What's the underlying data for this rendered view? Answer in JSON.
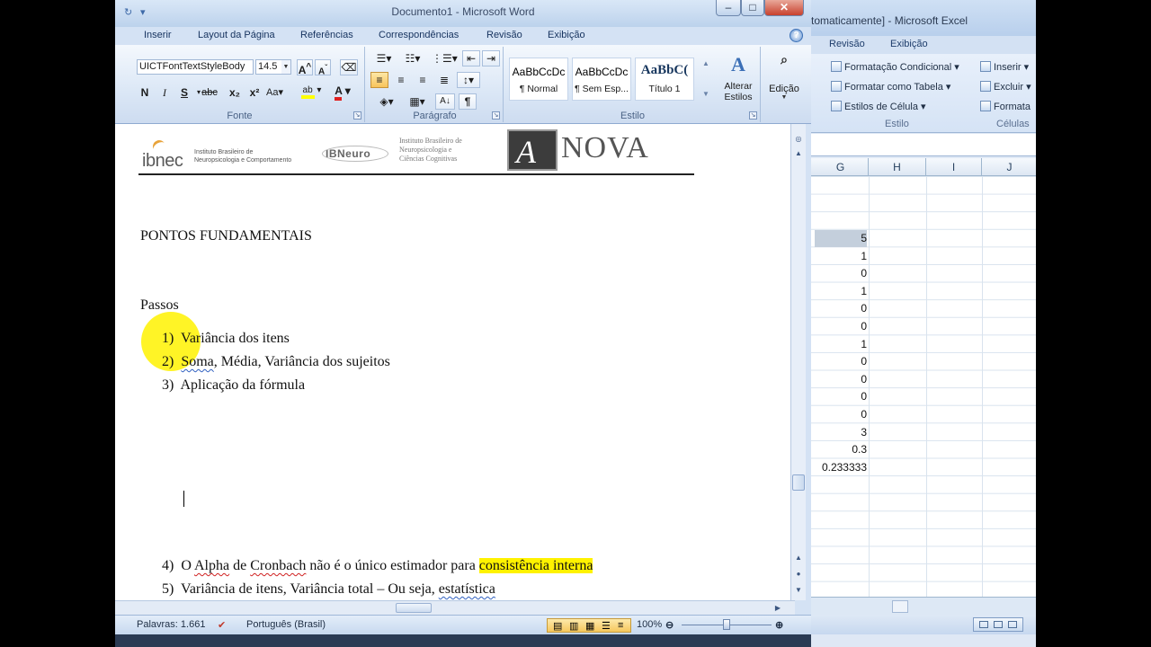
{
  "excel": {
    "title": "tomaticamente] - Microsoft Excel",
    "tabs": [
      "Revisão",
      "Exibição"
    ],
    "ribbon": {
      "conditional_formatting": "Formatação Condicional",
      "format_as_table": "Formatar como Tabela",
      "cell_styles": "Estilos de Célula",
      "insert": "Inserir",
      "delete": "Excluir",
      "format": "Formata",
      "group_styles": "Estilo",
      "group_cells": "Células"
    },
    "columns": [
      "G",
      "H",
      "I",
      "J"
    ],
    "cells": [
      "5",
      "1",
      "0",
      "1",
      "0",
      "0",
      "1",
      "0",
      "0",
      "0",
      "0",
      "3",
      "0.3",
      "0.233333"
    ]
  },
  "word": {
    "title": "Documento1 - Microsoft Word",
    "tabs": [
      "Inserir",
      "Layout da Página",
      "Referências",
      "Correspondências",
      "Revisão",
      "Exibição"
    ],
    "font": {
      "name": "UICTFontTextStyleBody",
      "size": "14.5",
      "group_label": "Fonte"
    },
    "paragraph": {
      "group_label": "Parágrafo"
    },
    "styles": {
      "items": [
        {
          "sample": "AaBbCcDc",
          "name": "¶ Normal"
        },
        {
          "sample": "AaBbCcDc",
          "name": "¶ Sem Esp..."
        },
        {
          "sample": "AaBbC(",
          "name": "Título 1"
        }
      ],
      "change_styles": "Alterar Estilos",
      "group_label": "Estilo"
    },
    "editing": {
      "label": "Edição"
    },
    "document": {
      "logo_ibnec": "ibnec",
      "logo_ibnec_sub1": "Instituto Brasileiro de",
      "logo_ibnec_sub2": "Neuropsicologia e Comportamento",
      "logo_ibneuro": "IBNeuro",
      "logo_inst1": "Instituto Brasileiro de",
      "logo_inst2": "Neuropsicologia e",
      "logo_inst3": "Ciências Cognitivas",
      "logo_anova": "NOVA",
      "heading": "PONTOS FUNDAMENTAIS",
      "subheading": "Passos",
      "list": [
        {
          "num": "1)",
          "text": "Variância dos itens"
        },
        {
          "num": "2)",
          "text_a": "Soma",
          "text_b": ", Média, Variância dos sujeitos"
        },
        {
          "num": "3)",
          "text": "Aplicação da fórmula"
        }
      ],
      "list2": [
        {
          "num": "4)",
          "t1": "O ",
          "t2": "Alpha",
          "t3": " de ",
          "t4": "Cronbach",
          "t5": " não é o único estimador para ",
          "t6": "consistência interna"
        },
        {
          "num": "5)",
          "t1": "Variância de itens, Variância total – Ou seja, ",
          "t2": "estatística"
        }
      ]
    },
    "status": {
      "words": "Palavras: 1.661",
      "language": "Português (Brasil)",
      "zoom": "100%"
    }
  }
}
